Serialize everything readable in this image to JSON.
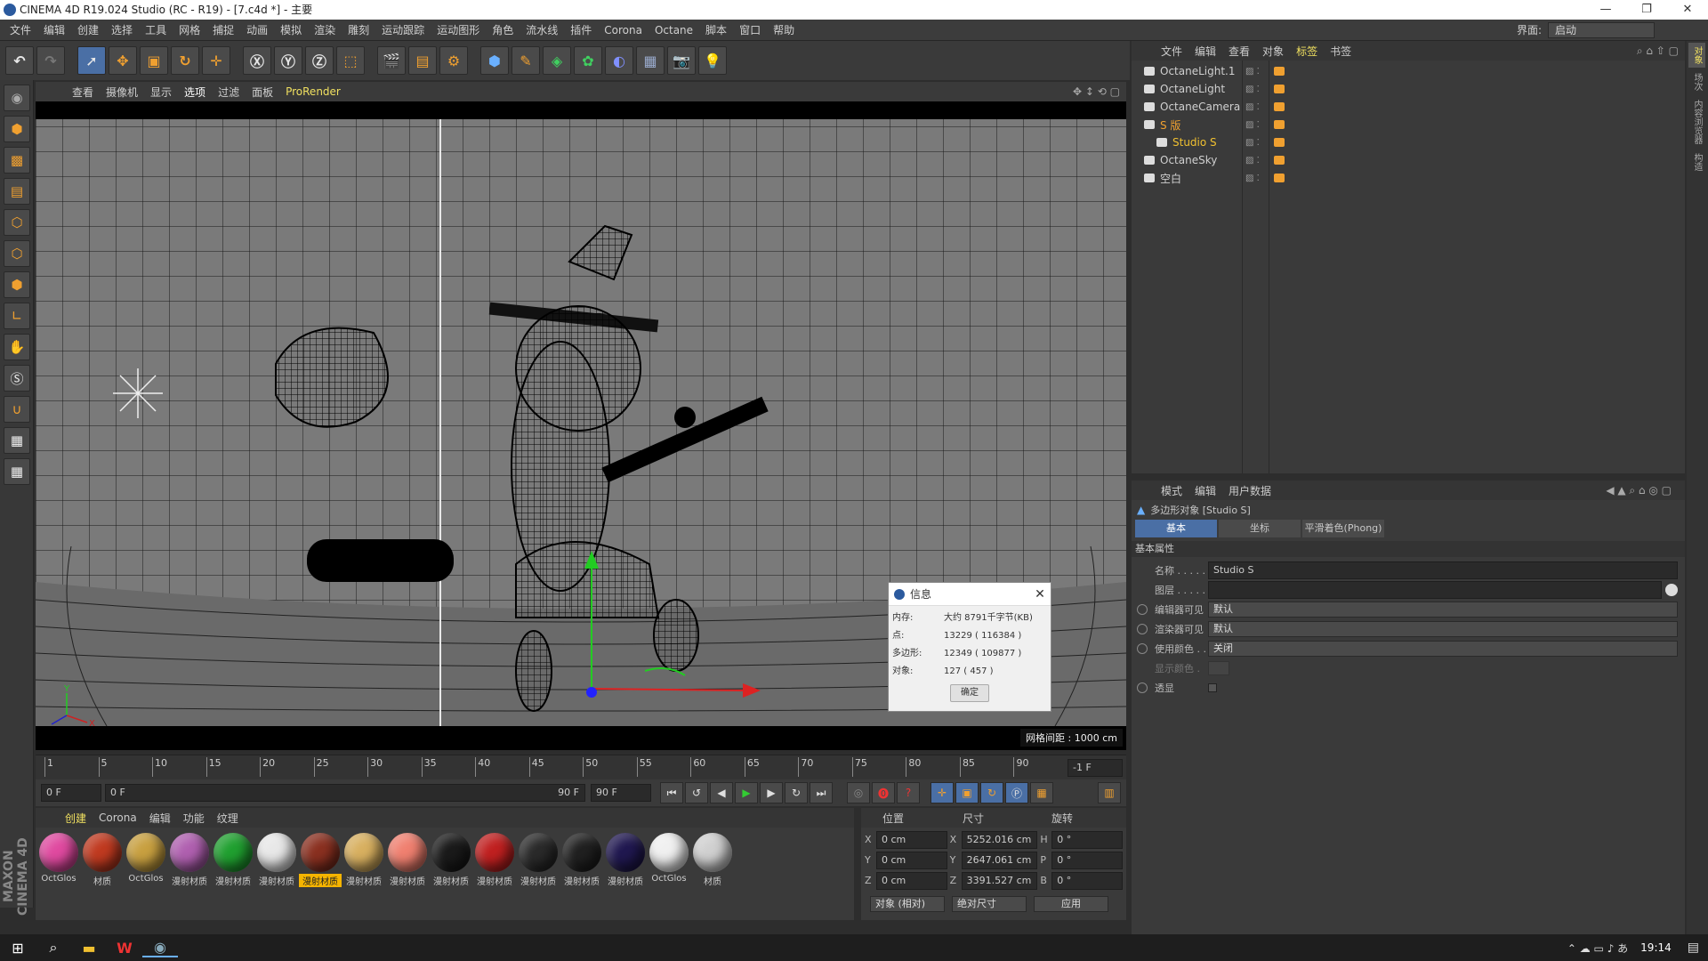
{
  "title_bar": {
    "title": "CINEMA 4D R19.024 Studio (RC - R19) - [7.c4d *] - 主要",
    "minimize": "—",
    "restore": "❐",
    "close": "✕"
  },
  "menubar": [
    "文件",
    "编辑",
    "创建",
    "选择",
    "工具",
    "网格",
    "捕捉",
    "动画",
    "模拟",
    "渲染",
    "雕刻",
    "运动跟踪",
    "运动图形",
    "角色",
    "流水线",
    "插件",
    "Corona",
    "Octane",
    "脚本",
    "窗口",
    "帮助"
  ],
  "layout": {
    "label": "界面:",
    "value": "启动"
  },
  "viewport_menu": [
    "查看",
    "摄像机",
    "显示",
    "选项",
    "过滤",
    "面板",
    "ProRender"
  ],
  "viewport": {
    "grid_spacing": "网格间距 : 1000 cm",
    "axis_y": "Y",
    "axis_x": "X"
  },
  "timeline": {
    "ticks": [
      "1",
      "5",
      "10",
      "15",
      "20",
      "25",
      "30",
      "35",
      "40",
      "45",
      "50",
      "55",
      "60",
      "65",
      "70",
      "75",
      "80",
      "85",
      "90"
    ],
    "current_frame": "-1 F"
  },
  "transport": {
    "start": "0 F",
    "range_start": "0 F",
    "range_end": "90 F",
    "end": "90 F"
  },
  "materials": {
    "tabs": [
      "创建",
      "Corona",
      "编辑",
      "功能",
      "纹理"
    ],
    "items": [
      {
        "label": "OctGlos",
        "color": "#e04aa0"
      },
      {
        "label": "材质",
        "color": "#c03a20"
      },
      {
        "label": "OctGlos",
        "color": "#c8a040"
      },
      {
        "label": "漫射材质",
        "color": "#b060b0"
      },
      {
        "label": "漫射材质",
        "color": "#20a030"
      },
      {
        "label": "漫射材质",
        "color": "#e8e8e8"
      },
      {
        "label": "漫射材质",
        "color": "#8a3020",
        "selected": true
      },
      {
        "label": "漫射材质",
        "color": "#d8b060"
      },
      {
        "label": "漫射材质",
        "color": "#f08070"
      },
      {
        "label": "漫射材质",
        "color": "#1a1a1a"
      },
      {
        "label": "漫射材质",
        "color": "#c02020"
      },
      {
        "label": "漫射材质",
        "color": "#2a2a2a"
      },
      {
        "label": "漫射材质",
        "color": "#202020"
      },
      {
        "label": "漫射材质",
        "color": "#201850"
      },
      {
        "label": "OctGlos",
        "color": "#f0f0f0"
      },
      {
        "label": "材质",
        "color": "#d0d0d0"
      }
    ]
  },
  "coords": {
    "headers": [
      "位置",
      "尺寸",
      "旋转"
    ],
    "rows": [
      {
        "axis": "X",
        "pos": "0 cm",
        "size_axis": "X",
        "size": "5252.016 cm",
        "rot_axis": "H",
        "rot": "0 °"
      },
      {
        "axis": "Y",
        "pos": "0 cm",
        "size_axis": "Y",
        "size": "2647.061 cm",
        "rot_axis": "P",
        "rot": "0 °"
      },
      {
        "axis": "Z",
        "pos": "0 cm",
        "size_axis": "Z",
        "size": "3391.527 cm",
        "rot_axis": "B",
        "rot": "0 °"
      }
    ],
    "mode": "对象 (相对)",
    "size_mode": "绝对尺寸",
    "apply": "应用"
  },
  "object_manager": {
    "menu": [
      "文件",
      "编辑",
      "查看",
      "对象",
      "标签",
      "书签"
    ],
    "objects": [
      {
        "name": "OctaneLight.1",
        "indent": 0
      },
      {
        "name": "OctaneLight",
        "indent": 0
      },
      {
        "name": "OctaneCamera",
        "indent": 0
      },
      {
        "name": "S 版",
        "indent": 0,
        "color": "#f0a030"
      },
      {
        "name": "Studio S",
        "indent": 1,
        "color": "#f0c030"
      },
      {
        "name": "OctaneSky",
        "indent": 0
      },
      {
        "name": "空白",
        "indent": 0
      }
    ]
  },
  "attributes": {
    "menu": [
      "模式",
      "编辑",
      "用户数据"
    ],
    "object_title": "多边形对象 [Studio S]",
    "tabs": [
      "基本",
      "坐标",
      "平滑着色(Phong)"
    ],
    "section": "基本属性",
    "name_label": "名称 . . . . .",
    "name_value": "Studio S",
    "layer_label": "图层 . . . . .",
    "editor_visible_label": "编辑器可见",
    "editor_visible": "默认",
    "render_visible_label": "渲染器可见",
    "render_visible": "默认",
    "use_color_label": "使用颜色 . .",
    "use_color": "关闭",
    "display_color_label": "显示颜色 .",
    "xray_label": "透显"
  },
  "info_dialog": {
    "title": "信息",
    "rows": [
      {
        "label": "内存:",
        "value": "大约 8791千字节(KB)"
      },
      {
        "label": "点:",
        "value": "13229 ( 116384 )"
      },
      {
        "label": "多边形:",
        "value": "12349 ( 109877 )"
      },
      {
        "label": "对象:",
        "value": "127 ( 457 )"
      }
    ],
    "ok": "确定"
  },
  "side_tabs": [
    "对象",
    "场次",
    "内容浏览器",
    "构造"
  ],
  "taskbar": {
    "time": "19:14"
  },
  "brand": "MAXON CINEMA 4D"
}
